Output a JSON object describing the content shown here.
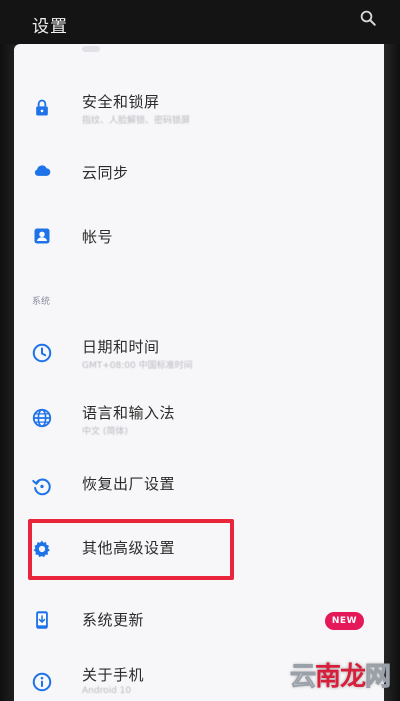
{
  "header": {
    "title": "设置",
    "search_icon": "search-icon"
  },
  "colors": {
    "accent": "#1e73e8",
    "badge": "#e5195a",
    "highlight": "#e8253a"
  },
  "items": [
    {
      "id": "security",
      "icon": "lock-icon",
      "label": "安全和锁屏",
      "sub": "指纹、人脸解锁、密码锁屏"
    },
    {
      "id": "cloud",
      "icon": "cloud-icon",
      "label": "云同步",
      "sub": ""
    },
    {
      "id": "account",
      "icon": "account-icon",
      "label": "帐号",
      "sub": ""
    }
  ],
  "section": {
    "label": "系统"
  },
  "system_items": [
    {
      "id": "datetime",
      "icon": "clock-icon",
      "label": "日期和时间",
      "sub": "GMT+08:00 中国标准时间"
    },
    {
      "id": "language",
      "icon": "globe-icon",
      "label": "语言和输入法",
      "sub": "中文 (简体)"
    },
    {
      "id": "reset",
      "icon": "restore-icon",
      "label": "恢复出厂设置",
      "sub": ""
    },
    {
      "id": "advanced",
      "icon": "gear-icon",
      "label": "其他高级设置",
      "sub": ""
    },
    {
      "id": "update",
      "icon": "phone-update-icon",
      "label": "系统更新",
      "sub": "",
      "badge": "NEW"
    },
    {
      "id": "about",
      "icon": "info-icon",
      "label": "关于手机",
      "sub": "Android 10"
    }
  ],
  "watermark": {
    "chars": [
      "云",
      "南",
      "龙",
      "网"
    ]
  }
}
